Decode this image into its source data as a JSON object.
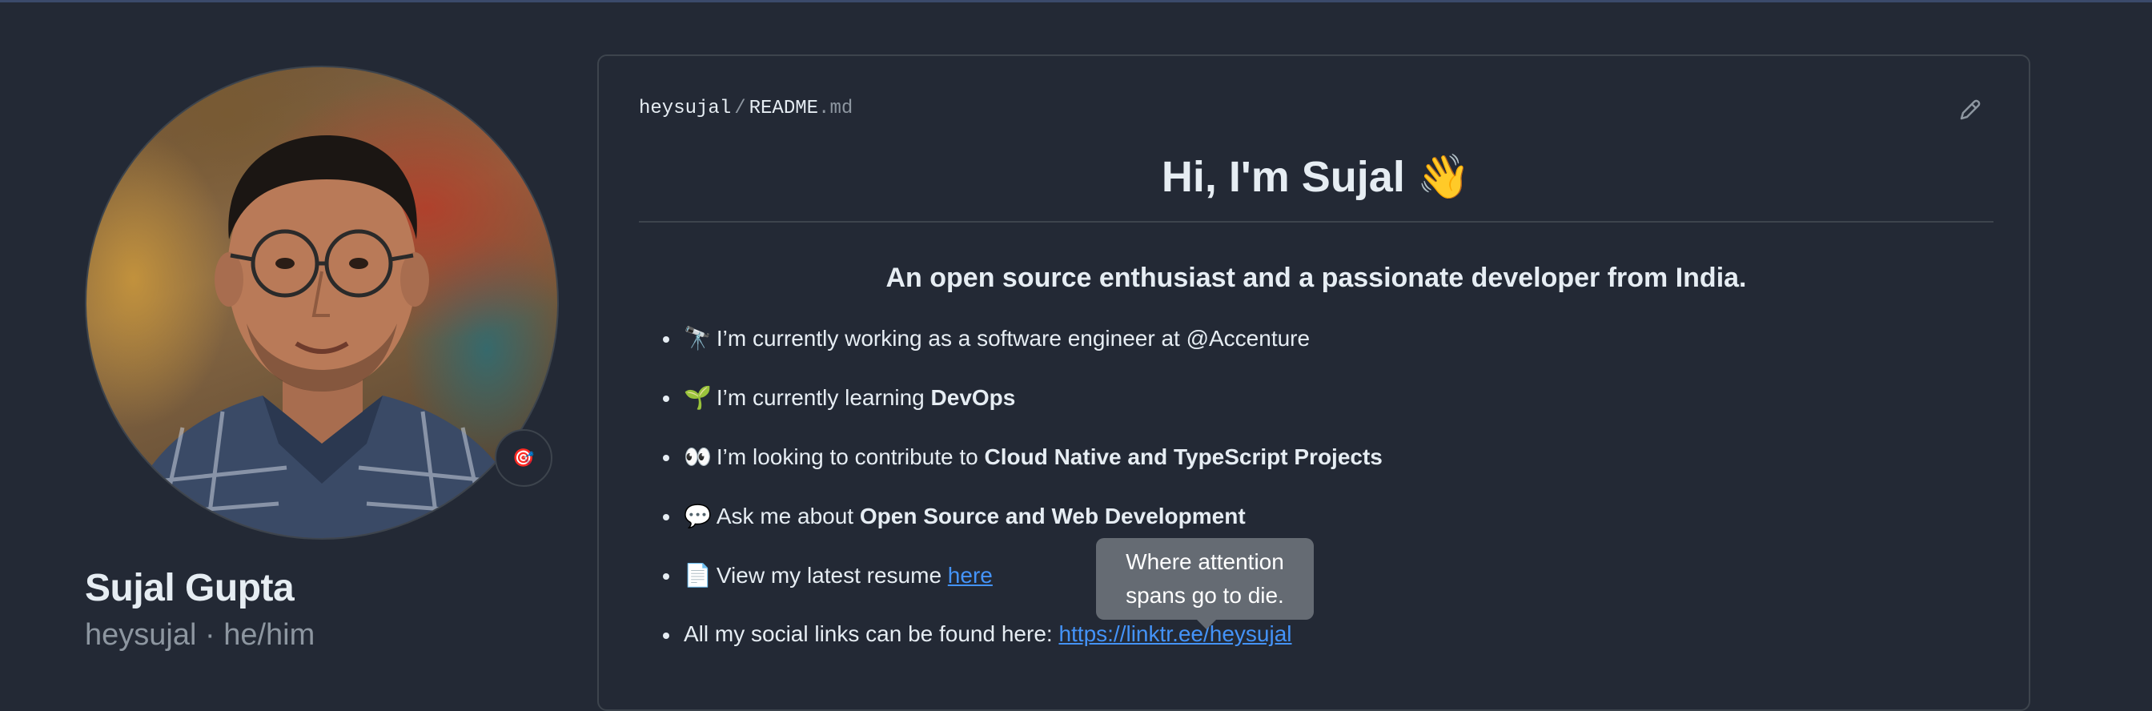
{
  "profile": {
    "display_name": "Sujal Gupta",
    "username_pronouns": "heysujal · he/him",
    "status_emoji": "🎯"
  },
  "readme": {
    "breadcrumb_user": "heysujal",
    "breadcrumb_sep": "/",
    "breadcrumb_file": "README",
    "breadcrumb_ext": ".md",
    "title": "Hi, I'm Sujal 👋",
    "subtitle": "An open source enthusiast and a passionate developer from India.",
    "bullets": [
      {
        "emoji": "🔭",
        "text": "I’m currently working as a software engineer at @Accenture"
      },
      {
        "emoji": "🌱",
        "text": "I’m currently learning ",
        "bold": "DevOps"
      },
      {
        "emoji": "👀",
        "text": "I’m looking to contribute to ",
        "bold": "Cloud Native and TypeScript Projects"
      },
      {
        "emoji": "💬",
        "text": "Ask me about ",
        "bold": "Open Source and Web Development"
      },
      {
        "emoji": "📄",
        "text": "View my latest resume ",
        "link": "here"
      },
      {
        "text": "All my social links can be found here: ",
        "link": "https://linktr.ee/heysujal"
      }
    ]
  },
  "tooltip": {
    "line1": "Where attention",
    "line2": "spans go to die."
  },
  "icons": {
    "edit": "pencil-icon",
    "status": "target-icon"
  },
  "colors": {
    "background": "#232935",
    "link": "#4493f8",
    "border": "#3d444d"
  }
}
